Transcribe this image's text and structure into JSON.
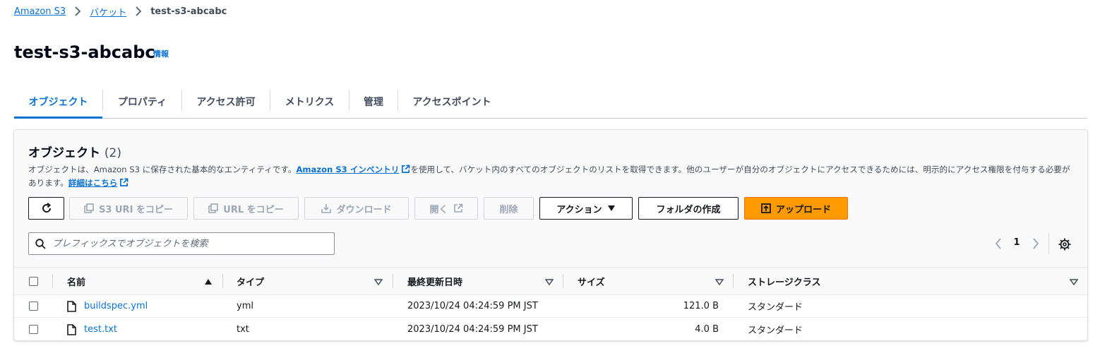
{
  "breadcrumb": {
    "items": [
      "Amazon S3",
      "バケット"
    ],
    "current": "test-s3-abcabc"
  },
  "page": {
    "title": "test-s3-abcabc",
    "info_label": "情報"
  },
  "tabs": [
    {
      "label": "オブジェクト",
      "active": true
    },
    {
      "label": "プロパティ",
      "active": false
    },
    {
      "label": "アクセス許可",
      "active": false
    },
    {
      "label": "メトリクス",
      "active": false
    },
    {
      "label": "管理",
      "active": false
    },
    {
      "label": "アクセスポイント",
      "active": false
    }
  ],
  "objects": {
    "heading": "オブジェクト",
    "count": "(2)",
    "desc_part1": "オブジェクトは、Amazon S3 に保存された基本的なエンティティです。",
    "desc_link1": "Amazon S3 インベントリ",
    "desc_part2": "を使用して、バケット内のすべてのオブジェクトのリストを取得できます。他のユーザーが自分のオブジェクトにアクセスできるためには、明示的にアクセス権限を付与する必要があります。",
    "desc_link2": "詳細はこちら"
  },
  "toolbar": {
    "copy_s3_uri": "S3 URI をコピー",
    "copy_url": "URL をコピー",
    "download": "ダウンロード",
    "open": "開く",
    "delete": "削除",
    "actions": "アクション",
    "create_folder": "フォルダの作成",
    "upload": "アップロード"
  },
  "search": {
    "placeholder": "プレフィックスでオブジェクトを検索"
  },
  "pagination": {
    "current_page": "1"
  },
  "table": {
    "headers": {
      "name": "名前",
      "type": "タイプ",
      "modified": "最終更新日時",
      "size": "サイズ",
      "storage_class": "ストレージクラス"
    },
    "rows": [
      {
        "name": "buildspec.yml",
        "type": "yml",
        "modified": "2023/10/24 04:24:59 PM JST",
        "size": "121.0 B",
        "storage_class": "スタンダード"
      },
      {
        "name": "test.txt",
        "type": "txt",
        "modified": "2023/10/24 04:24:59 PM JST",
        "size": "4.0 B",
        "storage_class": "スタンダード"
      }
    ]
  },
  "colors": {
    "link": "#0972d3",
    "primary_button": "#ff9900",
    "text": "#16191f",
    "disabled": "#9ba7b6"
  }
}
